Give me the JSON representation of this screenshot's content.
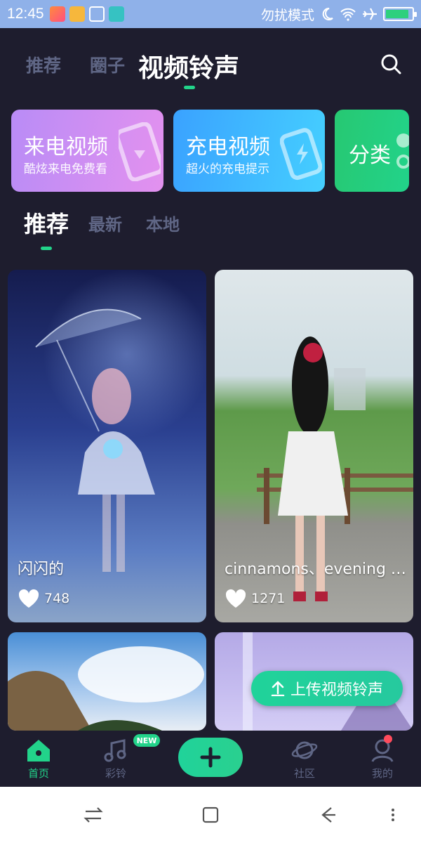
{
  "status_bar": {
    "time": "12:45",
    "dnd_text": "勿扰模式",
    "battery_level": 0.9
  },
  "header": {
    "tabs": [
      "推荐",
      "圈子",
      "视频铃声"
    ],
    "active_tab": "视频铃声",
    "search_icon": "search-icon"
  },
  "features": [
    {
      "title": "来电视频",
      "subtitle": "酷炫来电免费看",
      "icon": "phone-icon"
    },
    {
      "title": "充电视频",
      "subtitle": "超火的充电提示",
      "icon": "battery-charge-icon"
    },
    {
      "title": "分类",
      "icon": "category-icon"
    }
  ],
  "sub_tabs": {
    "items": [
      "推荐",
      "最新",
      "本地"
    ],
    "active": "推荐"
  },
  "videos": [
    {
      "name": "闪闪的",
      "likes": "748"
    },
    {
      "name": "cinnamons、evening ci...",
      "likes": "1271"
    },
    {
      "name": "",
      "likes": ""
    },
    {
      "name": "",
      "likes": ""
    }
  ],
  "upload_button": {
    "label": "上传视频铃声"
  },
  "bottom_nav": {
    "items": [
      {
        "label": "首页",
        "icon": "home-icon",
        "active": true
      },
      {
        "label": "彩铃",
        "icon": "music-note-icon",
        "badge": "NEW"
      },
      {
        "label": "",
        "icon": "plus-icon"
      },
      {
        "label": "社区",
        "icon": "planet-icon"
      },
      {
        "label": "我的",
        "icon": "user-icon",
        "dot": true
      }
    ]
  },
  "colors": {
    "background": "#1e1d2e",
    "accent": "#22d38a",
    "inactive_text": "#5f6685",
    "status_bar": "#8fb1e9"
  }
}
